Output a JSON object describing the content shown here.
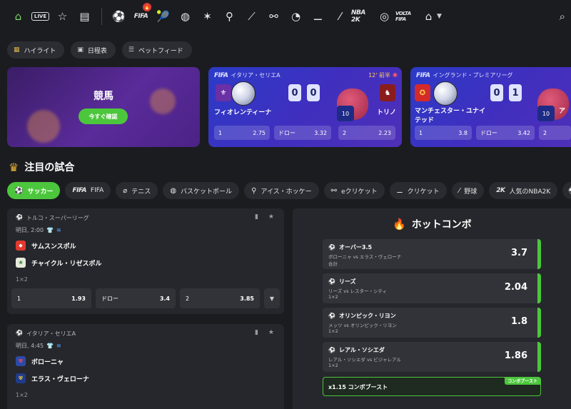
{
  "topbar": {
    "live_label": "LIVE",
    "fifa_label": "FIFA",
    "fifa_badge": "🔥",
    "nba_label": "NBA 2K",
    "volta_label": "VOLTA FIFA"
  },
  "pills": [
    "ハイライト",
    "日程表",
    "ベットフィード"
  ],
  "banner": {
    "title": "競馬",
    "cta": "今すぐ確認"
  },
  "featured": [
    {
      "league": "イタリア・セリエA",
      "time": "12' 前半",
      "home": "フィオレンティーナ",
      "away": "トリノ",
      "home_score": "0",
      "away_score": "0",
      "odds": [
        {
          "label": "1",
          "value": "2.75"
        },
        {
          "label": "ドロー",
          "value": "3.32"
        },
        {
          "label": "2",
          "value": "2.23"
        }
      ]
    },
    {
      "league": "イングランド・プレミアリーグ",
      "home": "マンチェスター・ユナイテッド",
      "away": "ア",
      "home_score": "0",
      "away_score": "1",
      "odds": [
        {
          "label": "1",
          "value": "3.8"
        },
        {
          "label": "ドロー",
          "value": "3.42"
        },
        {
          "label": "2",
          "value": ""
        }
      ]
    }
  ],
  "section_title": "注目の試合",
  "tabs": [
    "サッカー",
    "FIFA",
    "テニス",
    "バスケットボール",
    "アイス・ホッケー",
    "eクリケット",
    "クリケット",
    "野球",
    "人気のNBA2K"
  ],
  "matches": [
    {
      "league": "トルコ・スーパーリーグ",
      "time": "明日, 2:00",
      "home": "サムスンスポル",
      "away": "チャイクル・リゼスポル",
      "market": "1×2",
      "odds": [
        {
          "label": "1",
          "value": "1.93"
        },
        {
          "label": "ドロー",
          "value": "3.4"
        },
        {
          "label": "2",
          "value": "3.85"
        }
      ]
    },
    {
      "league": "イタリア・セリエA",
      "time": "明日, 4:45",
      "home": "ボローニャ",
      "away": "エラス・ヴェローナ",
      "market": "1×2"
    }
  ],
  "hot_combo": {
    "title": "ホットコンボ",
    "items": [
      {
        "selection": "オーバー3.5",
        "match": "ボローニャ vs エラス・ヴェローナ",
        "market": "合計",
        "odd": "3.7"
      },
      {
        "selection": "リーズ",
        "match": "リーズ vs レスター・シティ",
        "market": "1×2",
        "odd": "2.04"
      },
      {
        "selection": "オリンピック・リヨン",
        "match": "メッツ vs オリンピック・リヨン",
        "market": "1×2",
        "odd": "1.8"
      },
      {
        "selection": "レアル・ソシエダ",
        "match": "レアル・ソシエダ vs ビジャレアル",
        "market": "1×2",
        "odd": "1.86"
      }
    ],
    "boost_label": "x1.15 コンボブースト",
    "boost_tag": "コンボブースト"
  }
}
